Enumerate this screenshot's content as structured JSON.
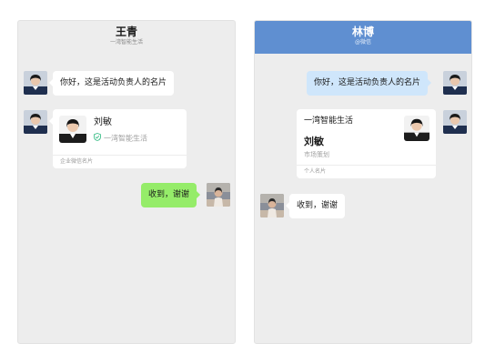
{
  "left_chat": {
    "title": "王青",
    "subtitle": "一湾智能生活",
    "messages": {
      "greeting": "你好，这是活动负责人的名片",
      "reply": "收到，谢谢"
    },
    "card": {
      "name": "刘敏",
      "company": "一湾智能生活",
      "footer": "企业微信名片"
    }
  },
  "right_chat": {
    "title": "林博",
    "subtitle": "@微信",
    "messages": {
      "greeting": "你好，这是活动负责人的名片",
      "reply": "收到，谢谢"
    },
    "card": {
      "company": "一湾智能生活",
      "name": "刘敏",
      "position": "市场策划",
      "footer": "个人名片"
    }
  },
  "colors": {
    "header_blue": "#5f8fd1",
    "bubble_green": "#95ec69",
    "bubble_blue": "#cfe6fb",
    "verified_green": "#3fbf8a"
  },
  "icons": {
    "verified": "verified-shield-icon"
  }
}
